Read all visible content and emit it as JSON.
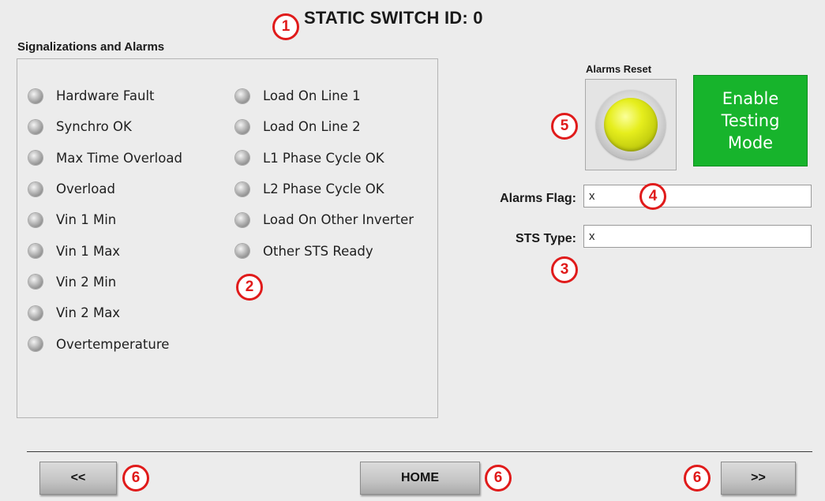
{
  "header": {
    "title": "STATIC SWITCH ID:  0"
  },
  "signals": {
    "section_label": "Signalizations and Alarms",
    "column1": [
      "Hardware Fault",
      "Synchro OK",
      "Max Time Overload",
      "Overload",
      "Vin 1 Min",
      "Vin 1 Max",
      "Vin 2 Min",
      "Vin 2 Max",
      "Overtemperature"
    ],
    "column2": [
      "Load On Line 1",
      "Load On Line 2",
      "L1 Phase Cycle OK",
      "L2 Phase Cycle OK",
      "Load On Other Inverter",
      "Other STS Ready"
    ],
    "led_state": "off",
    "led_color": "#b0b0b0"
  },
  "alarms_reset": {
    "label": "Alarms Reset",
    "lamp_color": "#e6ee1d",
    "icon": "indicator-lamp-icon"
  },
  "testing": {
    "label": "Enable Testing Mode",
    "color": "#17b42c"
  },
  "fields": {
    "alarms_flag": {
      "label": "Alarms Flag:",
      "value": "x"
    },
    "sts_type": {
      "label": "STS Type:",
      "value": "x"
    }
  },
  "nav": {
    "prev_label": "<<",
    "home_label": "HOME",
    "next_label": ">>"
  },
  "callouts": [
    "1",
    "2",
    "3",
    "4",
    "5",
    "6",
    "6",
    "6"
  ],
  "callout_color": "#e01b1b"
}
